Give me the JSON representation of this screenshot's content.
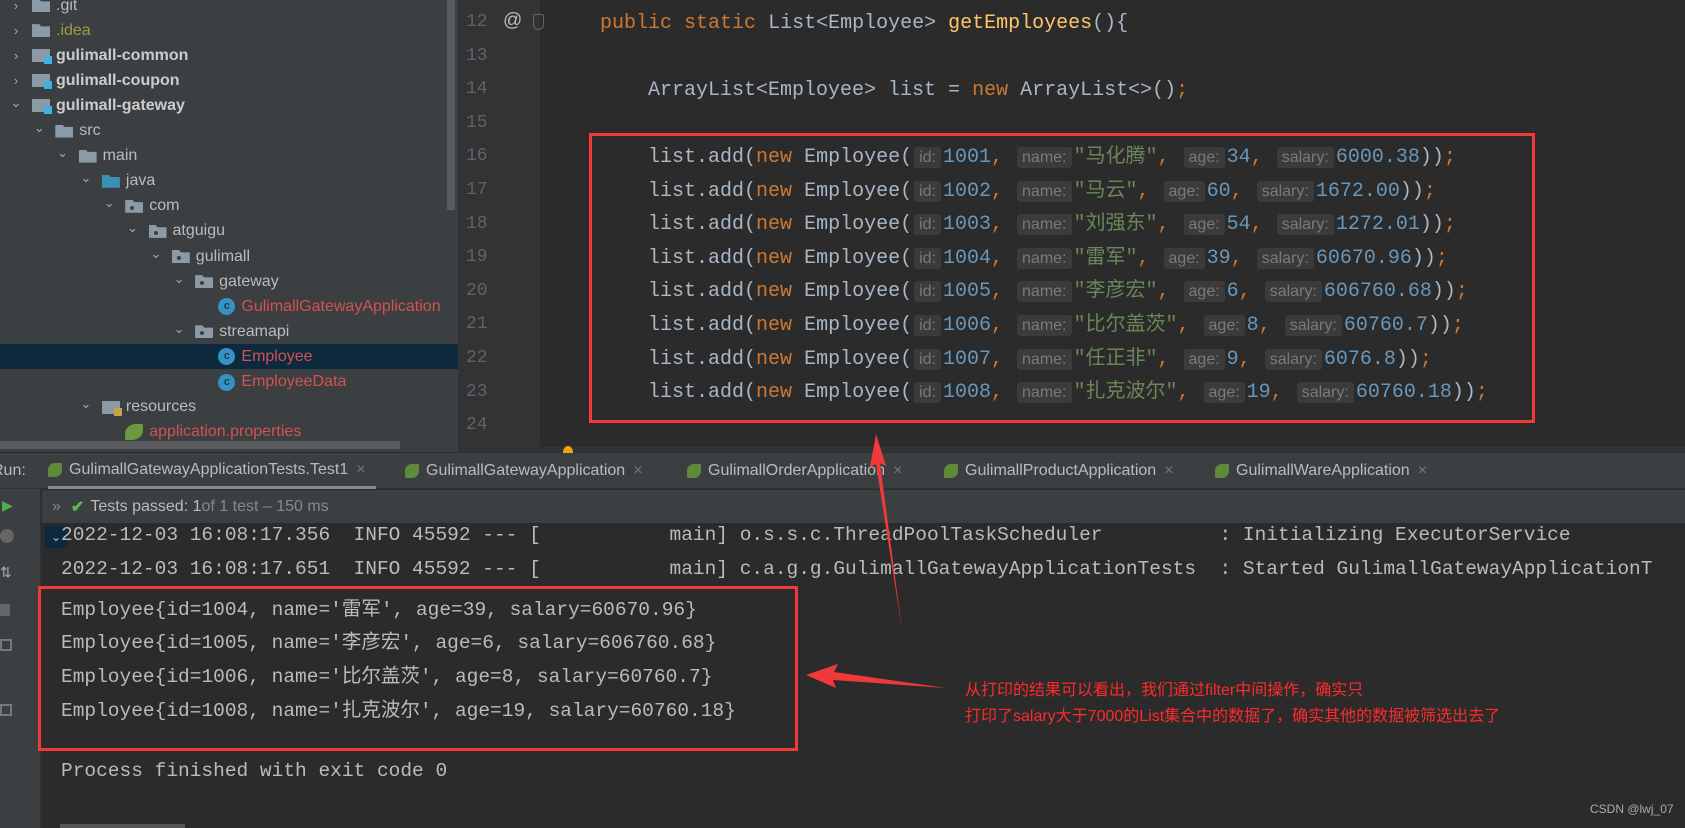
{
  "tree": [
    {
      "label": ".git",
      "depth": 0,
      "icon": "folder",
      "open": false,
      "color": "#bbbbbb",
      "bold": false
    },
    {
      "label": ".idea",
      "depth": 0,
      "icon": "folder",
      "open": false,
      "color": "#9c9c3b",
      "bold": false
    },
    {
      "label": "gulimall-common",
      "depth": 0,
      "icon": "module",
      "open": false,
      "color": "#cccccc",
      "bold": true
    },
    {
      "label": "gulimall-coupon",
      "depth": 0,
      "icon": "module",
      "open": false,
      "color": "#cccccc",
      "bold": true
    },
    {
      "label": "gulimall-gateway",
      "depth": 0,
      "icon": "module",
      "open": true,
      "color": "#cccccc",
      "bold": true
    },
    {
      "label": "src",
      "depth": 1,
      "icon": "folder",
      "open": true,
      "color": "#bbbbbb",
      "bold": false
    },
    {
      "label": "main",
      "depth": 2,
      "icon": "folder",
      "open": true,
      "color": "#bbbbbb",
      "bold": false
    },
    {
      "label": "java",
      "depth": 3,
      "icon": "src",
      "open": true,
      "color": "#bbbbbb",
      "bold": false
    },
    {
      "label": "com",
      "depth": 4,
      "icon": "pkg",
      "open": true,
      "color": "#bbbbbb",
      "bold": false
    },
    {
      "label": "atguigu",
      "depth": 5,
      "icon": "pkg",
      "open": true,
      "color": "#bbbbbb",
      "bold": false
    },
    {
      "label": "gulimall",
      "depth": 6,
      "icon": "pkg",
      "open": true,
      "color": "#bbbbbb",
      "bold": false
    },
    {
      "label": "gateway",
      "depth": 7,
      "icon": "pkg",
      "open": true,
      "color": "#bbbbbb",
      "bold": false
    },
    {
      "label": "GulimallGatewayApplication",
      "depth": 8,
      "icon": "cls",
      "open": null,
      "color": "#d25252",
      "bold": false
    },
    {
      "label": "streamapi",
      "depth": 7,
      "icon": "pkg",
      "open": true,
      "color": "#bbbbbb",
      "bold": false
    },
    {
      "label": "Employee",
      "depth": 8,
      "icon": "cls",
      "open": null,
      "color": "#d25252",
      "bold": false,
      "selected": true
    },
    {
      "label": "EmployeeData",
      "depth": 8,
      "icon": "cls",
      "open": null,
      "color": "#d25252",
      "bold": false
    },
    {
      "label": "resources",
      "depth": 3,
      "icon": "res",
      "open": true,
      "color": "#bbbbbb",
      "bold": false
    },
    {
      "label": "application.properties",
      "depth": 4,
      "icon": "spring",
      "open": null,
      "color": "#d25252",
      "bold": false
    }
  ],
  "editor": {
    "line_numbers": [
      "12",
      "13",
      "14",
      "15",
      "16",
      "17",
      "18",
      "19",
      "20",
      "21",
      "22",
      "23",
      "24"
    ],
    "signature": {
      "mod1": "public",
      "mod2": "static",
      "type": "List<Employee>",
      "method": "getEmployees",
      "tail": "(){"
    },
    "decl": {
      "type": "ArrayList<Employee> list = ",
      "kw": "new",
      "rest": "ArrayList<>()",
      "semi": ";"
    },
    "hint_labels": {
      "id": "id:",
      "name": "name:",
      "age": "age:",
      "salary": "salary:"
    },
    "call_prefix": "list.add(",
    "new_kw": "new",
    "ctor": "Employee(",
    "call_suffix": "))",
    "rows": [
      {
        "id": "1001",
        "name": "\"马化腾\"",
        "age": "34",
        "salary": "6000.38"
      },
      {
        "id": "1002",
        "name": "\"马云\"",
        "age": "60",
        "salary": "1672.00"
      },
      {
        "id": "1003",
        "name": "\"刘强东\"",
        "age": "54",
        "salary": "1272.01"
      },
      {
        "id": "1004",
        "name": "\"雷军\"",
        "age": "39",
        "salary": "60670.96"
      },
      {
        "id": "1005",
        "name": "\"李彦宏\"",
        "age": "6",
        "salary": "606760.68"
      },
      {
        "id": "1006",
        "name": "\"比尔盖茨\"",
        "age": "8",
        "salary": "60760.7"
      },
      {
        "id": "1007",
        "name": "\"任正非\"",
        "age": "9",
        "salary": "6076.8"
      },
      {
        "id": "1008",
        "name": "\"扎克波尔\"",
        "age": "19",
        "salary": "60760.18"
      }
    ]
  },
  "run": {
    "label": "Run:",
    "tabs": [
      {
        "label": "GulimallGatewayApplicationTests.Test1",
        "active": true
      },
      {
        "label": "GulimallGatewayApplication"
      },
      {
        "label": "GulimallOrderApplication"
      },
      {
        "label": "GulimallProductApplication"
      },
      {
        "label": "GulimallWareApplication"
      }
    ],
    "status_main": "Tests passed: 1",
    "status_rest": " of 1 test – 150 ms"
  },
  "console": {
    "lines": [
      "2022-12-03 16:08:17.356  INFO 45592 --- [           main] o.s.s.c.ThreadPoolTaskScheduler          : Initializing ExecutorService",
      "2022-12-03 16:08:17.651  INFO 45592 --- [           main] c.a.g.g.GulimallGatewayApplicationTests  : Started GulimallGatewayApplicationT",
      "Employee{id=1004, name='雷军', age=39, salary=60670.96}",
      "Employee{id=1005, name='李彦宏', age=6, salary=606760.68}",
      "Employee{id=1006, name='比尔盖茨', age=8, salary=60760.7}",
      "Employee{id=1008, name='扎克波尔', age=19, salary=60760.18}",
      "Process finished with exit code 0"
    ]
  },
  "annotation": {
    "line1": "从打印的结果可以看出，我们通过filter中间操作，确实只",
    "line2": "打印了salary大于7000的List集合中的数据了，确实其他的数据被筛选出去了"
  },
  "watermark": "CSDN @lwj_07"
}
